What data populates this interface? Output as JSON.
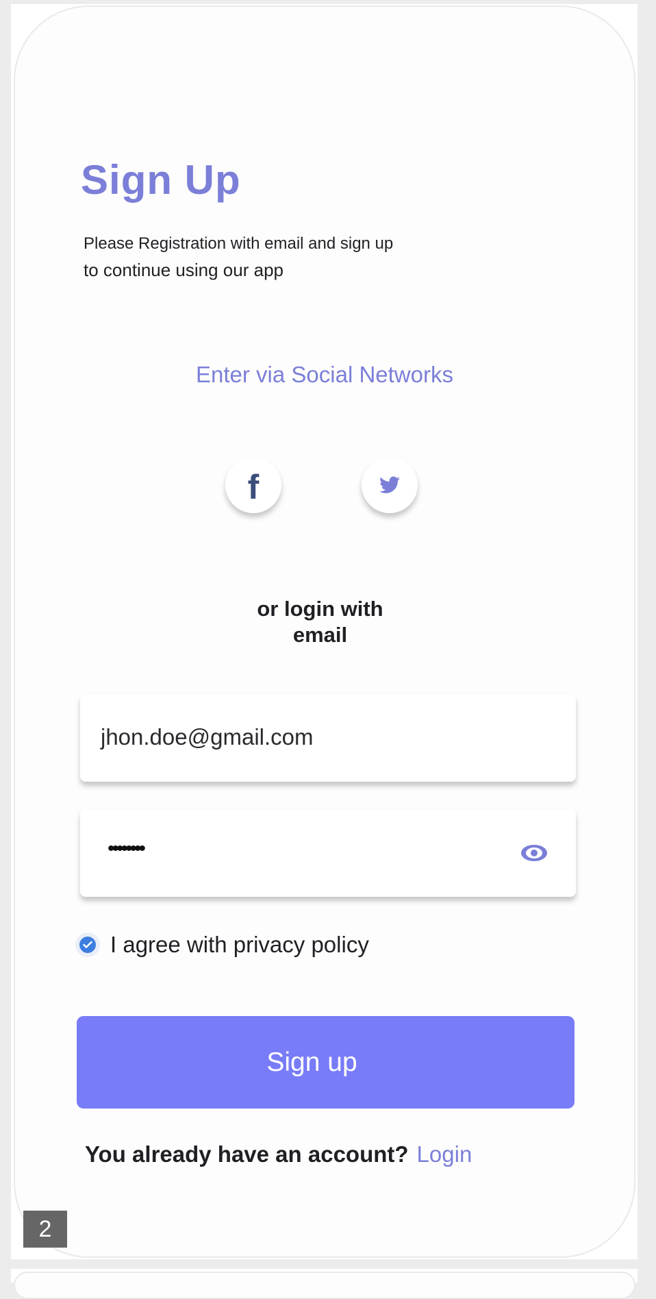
{
  "screen": {
    "title": "Sign Up",
    "subtitle_line1": "Please Registration with email and sign up",
    "subtitle_line2": "to continue using our app"
  },
  "social": {
    "heading": "Enter via Social Networks",
    "facebook_icon": "facebook-icon",
    "twitter_icon": "twitter-icon"
  },
  "divider": {
    "line1": "or login with",
    "line2": "email"
  },
  "form": {
    "email_value": "jhon.doe@gmail.com",
    "password_masked": "••••••••",
    "show_password_icon": "eye-icon",
    "agree_checked": true,
    "agree_label": "I agree with privacy policy",
    "submit_label": "Sign up"
  },
  "footer": {
    "question": "You already have an account?",
    "login_label": "Login"
  },
  "page_number": "2",
  "colors": {
    "accent": "#7b7fd8",
    "button": "#787cf8",
    "checkbox": "#3d7fe0",
    "background": "#fdfdfd"
  }
}
